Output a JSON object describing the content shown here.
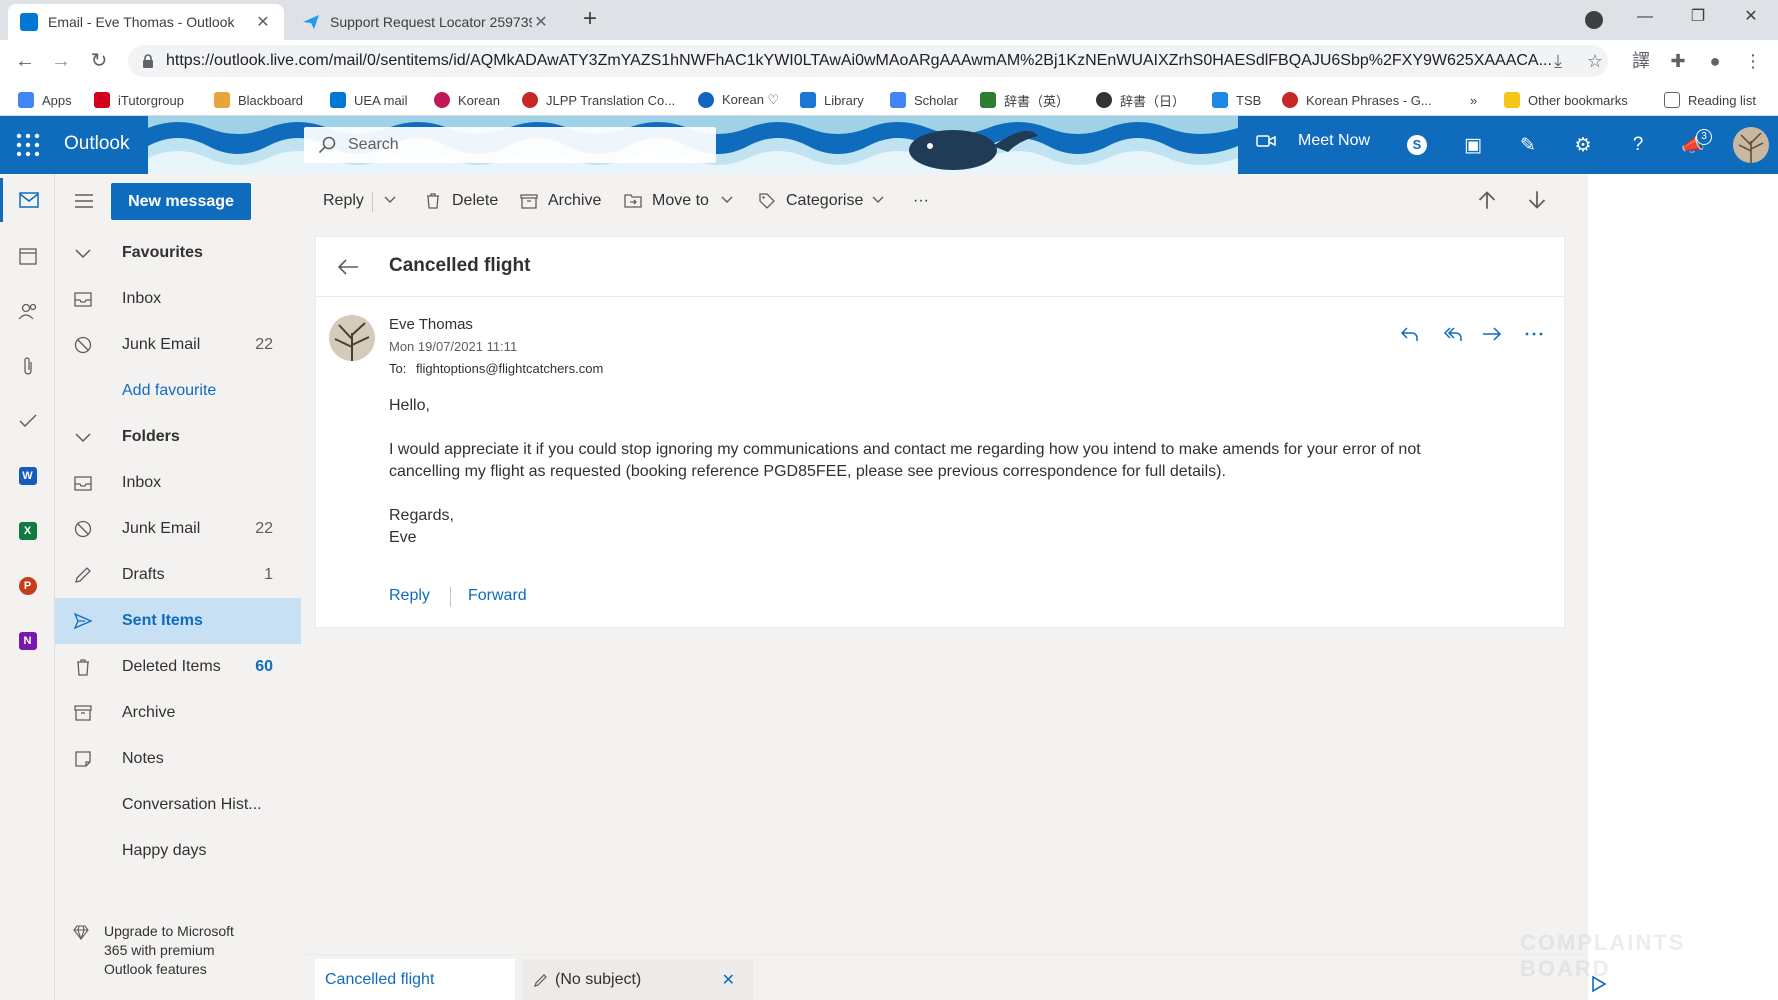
{
  "browser": {
    "tabs": [
      {
        "title": "Email - Eve Thomas - Outlook",
        "favicon": "outlook-icon",
        "color": "#0078d4",
        "active": true
      },
      {
        "title": "Support Request Locator 259739",
        "favicon": "paper-plane-icon",
        "color": "#1d9bf0",
        "active": false
      }
    ],
    "url": "https://outlook.live.com/mail/0/sentitems/id/AQMkADAwATY3ZmYAZS1hNWFhAC1kYWI0LTAwAi0wMAoARgAAAwmAM%2Bj1KzNEnWUAIXZrhS0HAESdlFBQAJU6Sbp%2FXY9W625XAAACA...",
    "bookmarks": [
      {
        "label": "Apps",
        "color": "#4285f4"
      },
      {
        "label": "iTutorgroup",
        "color": "#d0021b"
      },
      {
        "label": "Blackboard",
        "color": "#e8a33d"
      },
      {
        "label": "UEA mail",
        "color": "#0078d4"
      },
      {
        "label": "Korean",
        "color": "#c2185b"
      },
      {
        "label": "JLPP Translation Co...",
        "color": "#c62828"
      },
      {
        "label": "Korean ♡",
        "color": "#1565c0"
      },
      {
        "label": "Library",
        "color": "#1976d2"
      },
      {
        "label": "Scholar",
        "color": "#4285f4"
      },
      {
        "label": "辞書（英）",
        "color": "#2e7d32"
      },
      {
        "label": "辞書（日）",
        "color": "#333333"
      },
      {
        "label": "TSB",
        "color": "#1e88e5"
      },
      {
        "label": "Korean Phrases - G...",
        "color": "#c62828"
      },
      {
        "label": "»",
        "color": ""
      },
      {
        "label": "Other bookmarks",
        "color": "#f5c518"
      },
      {
        "label": "Reading list",
        "color": "#5f6368"
      }
    ]
  },
  "header": {
    "brand": "Outlook",
    "search_placeholder": "Search",
    "meet_now": "Meet Now",
    "notification_count": "3",
    "accent": "#0f6cbd"
  },
  "toolbar": {
    "new_message": "New message",
    "reply": "Reply",
    "delete": "Delete",
    "archive": "Archive",
    "move_to": "Move to",
    "categorise": "Categorise",
    "more": "···"
  },
  "folders": {
    "favourites_header": "Favourites",
    "favourites": [
      {
        "label": "Inbox",
        "count": "",
        "icon": "inbox-icon"
      },
      {
        "label": "Junk Email",
        "count": "22",
        "icon": "junk-icon"
      },
      {
        "label": "Add favourite",
        "count": "",
        "icon": ""
      }
    ],
    "folders_header": "Folders",
    "items": [
      {
        "label": "Inbox",
        "count": "",
        "icon": "inbox-icon"
      },
      {
        "label": "Junk Email",
        "count": "22",
        "icon": "junk-icon"
      },
      {
        "label": "Drafts",
        "count": "1",
        "icon": "pencil-icon"
      },
      {
        "label": "Sent Items",
        "count": "",
        "icon": "send-icon",
        "selected": true
      },
      {
        "label": "Deleted Items",
        "count": "60",
        "icon": "trash-icon"
      },
      {
        "label": "Archive",
        "count": "",
        "icon": "archive-icon"
      },
      {
        "label": "Notes",
        "count": "",
        "icon": "note-icon"
      },
      {
        "label": "Conversation Hist...",
        "count": "",
        "icon": ""
      },
      {
        "label": "Happy days",
        "count": "",
        "icon": ""
      }
    ],
    "upgrade": [
      "Upgrade to Microsoft",
      "365 with premium",
      "Outlook features"
    ]
  },
  "message": {
    "subject": "Cancelled flight",
    "sender": "Eve Thomas",
    "date": "Mon 19/07/2021 11:11",
    "to_label": "To:",
    "to": "flightoptions@flightcatchers.com",
    "greeting": "Hello,",
    "body_line1": "I would appreciate it if you could stop ignoring my communications and contact me regarding how you intend to make amends for your error of not",
    "body_line2": "cancelling my flight as requested (booking reference PGD85FEE, please see previous correspondence for full details).",
    "closing": "Regards,",
    "signature": "Eve",
    "reply_link": "Reply",
    "forward_link": "Forward"
  },
  "bottom_tabs": {
    "active": "Cancelled flight",
    "draft": "(No subject)"
  },
  "watermark": "COMPLAINTS BOARD"
}
